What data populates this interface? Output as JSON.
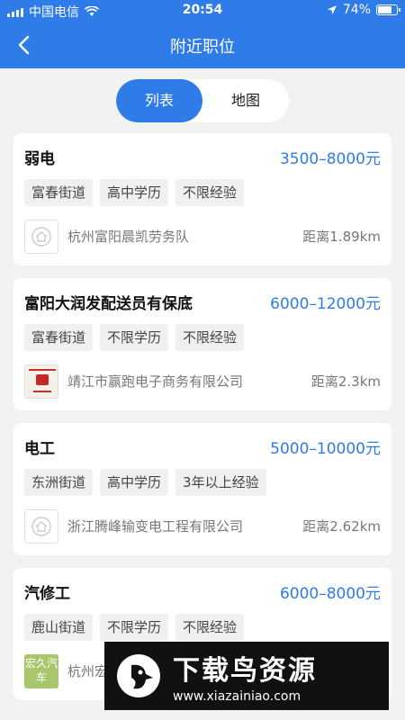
{
  "status_bar": {
    "carrier": "中国电信",
    "time": "20:54",
    "battery_percent": "74%",
    "battery_level": 0.74
  },
  "nav": {
    "title": "附近职位"
  },
  "view_toggle": {
    "list": "列表",
    "map": "地图",
    "active": "list"
  },
  "jobs": [
    {
      "title": "弱电",
      "salary": "3500–8000元",
      "tags": [
        "富春街道",
        "高中学历",
        "不限经验"
      ],
      "company": "杭州富阳晨凯劳务队",
      "distance": "距离1.89km",
      "logo": "placeholder-logo-icon"
    },
    {
      "title": "富阳大润发配送员有保底",
      "salary": "6000–12000元",
      "tags": [
        "富春街道",
        "不限学历",
        "不限经验"
      ],
      "company": "靖江市赢跑电子商务有限公司",
      "distance": "距离2.3km",
      "logo": "company-photo-logo"
    },
    {
      "title": "电工",
      "salary": "5000–10000元",
      "tags": [
        "东洲街道",
        "高中学历",
        "3年以上经验"
      ],
      "company": "浙江腾峰输变电工程有限公司",
      "distance": "距离2.62km",
      "logo": "placeholder-logo-icon"
    },
    {
      "title": "汽修工",
      "salary": "6000–8000元",
      "tags": [
        "鹿山街道",
        "不限学历",
        "不限经验"
      ],
      "company": "杭州宏",
      "distance": "",
      "logo": "green-company-logo",
      "logo_text": "宏久汽车"
    }
  ],
  "watermark": {
    "title": "下载鸟资源",
    "url": "www.xiazainiao.com"
  },
  "colors": {
    "primary": "#2f7be7",
    "background": "#f2f2f2",
    "card": "#ffffff",
    "tag_bg": "#f0f0f0"
  }
}
